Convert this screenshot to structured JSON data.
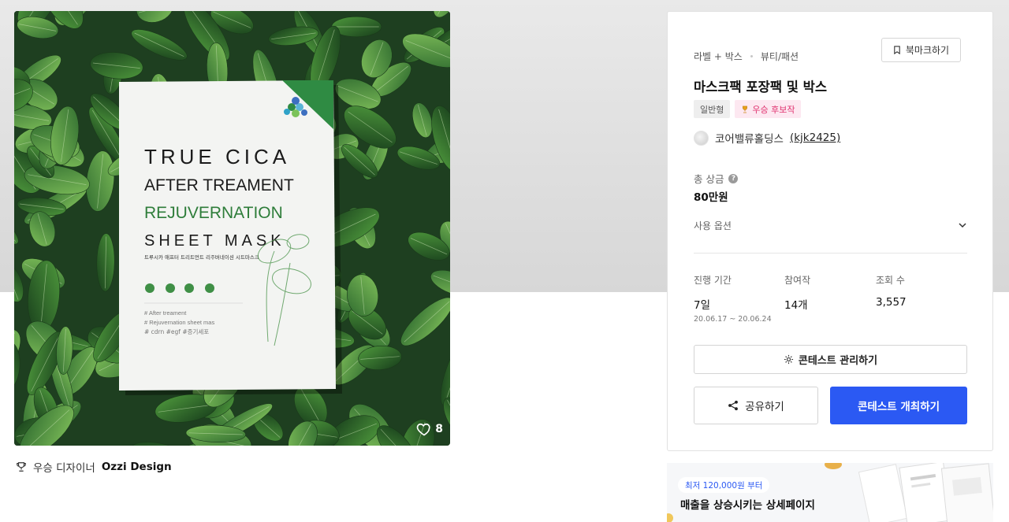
{
  "product": {
    "image": {
      "mask_lines": [
        "TRUE CICA",
        "AFTER TREAMENT",
        "REJUVERNATION",
        "SHEET MASK"
      ],
      "mask_korean": "트루시카 애프터 트리트먼트 리주버네이션 시트마스크",
      "mask_hashtags": [
        "# After treament",
        "# Rejuvernation sheet mas",
        "# cdrn #egf #증기세포"
      ],
      "leaf_color": "#2f6b2f",
      "mask_bg": "#f3f4f2"
    },
    "likes": "8",
    "winner_prefix": "우승 디자이너",
    "winner_name": "Ozzi Design"
  },
  "panel": {
    "category_main": "라벨 + 박스",
    "category_sub": "뷰티/패션",
    "bookmark_label": "북마크하기",
    "title": "마스크팩 포장팩 및 박스",
    "tags": [
      "일반형",
      "우승 후보작"
    ],
    "host_name": "코어밸류홀딩스",
    "host_handle": "(kjk2425)",
    "prize_label": "총 상금",
    "prize_value": "80만원",
    "options_label": "사용 옵션",
    "stats": {
      "duration_label": "진행 기간",
      "duration_value": "7일",
      "duration_range": "20.06.17 ~ 20.06.24",
      "participants_label": "참여작",
      "participants_value": "14개",
      "views_label": "조회 수",
      "views_value": "3,557"
    },
    "manage_label": "콘테스트 관리하기",
    "share_label": "공유하기",
    "host_contest_label": "콘테스트 개최하기",
    "accent_color": "#2b59f3"
  },
  "ad": {
    "badge": "최저 120,000원 부터",
    "headline": "매출을 상승시키는 상세페이지"
  }
}
